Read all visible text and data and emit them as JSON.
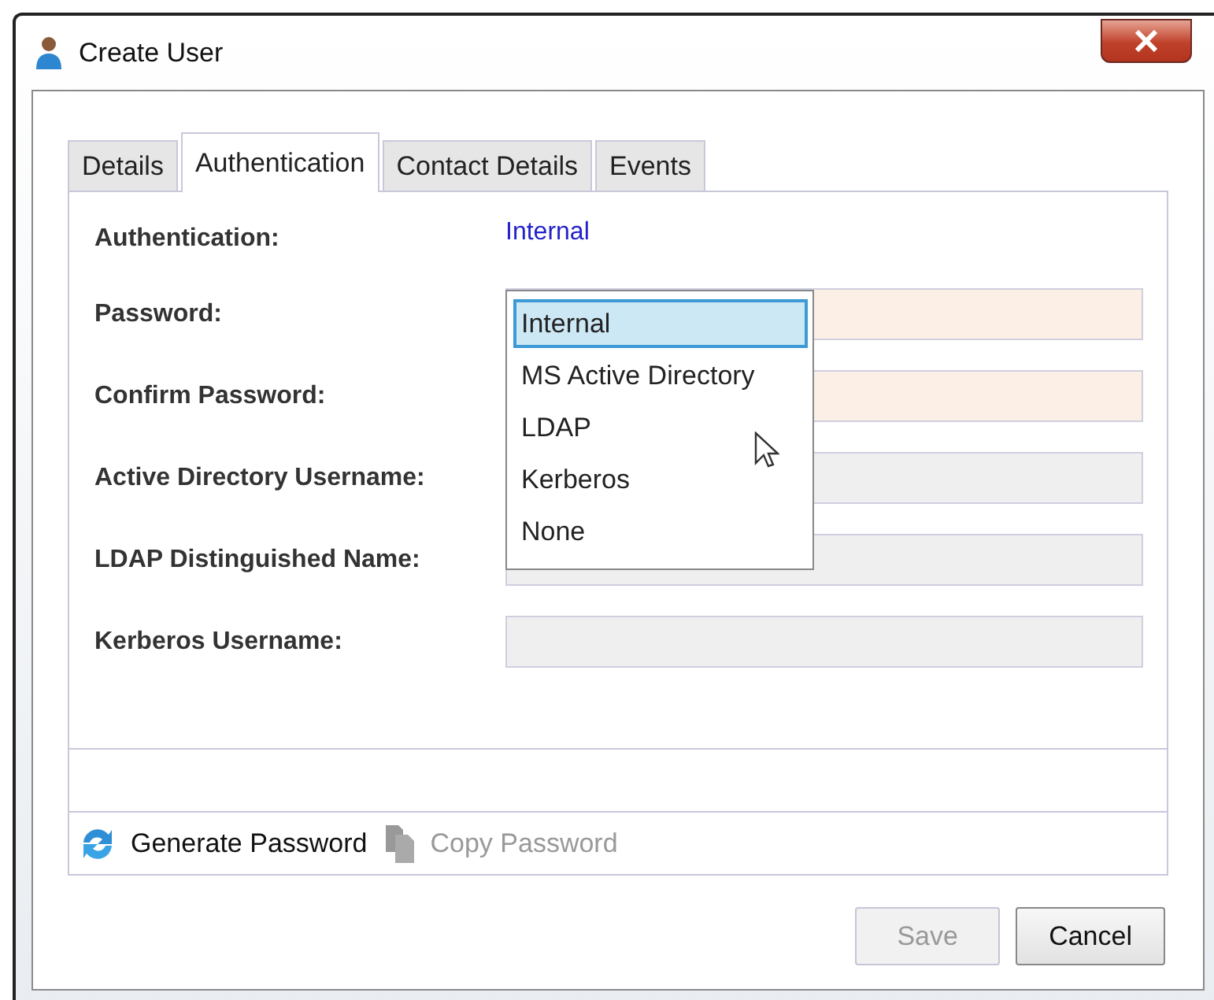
{
  "window": {
    "title": "Create User"
  },
  "tabs": [
    {
      "label": "Details",
      "selected": false
    },
    {
      "label": "Authentication",
      "selected": true
    },
    {
      "label": "Contact Details",
      "selected": false
    },
    {
      "label": "Events",
      "selected": false
    }
  ],
  "form": [
    {
      "label": "Authentication:",
      "kind": "value",
      "value": "Internal"
    },
    {
      "label": "Password:",
      "kind": "field",
      "required": true,
      "disabled": false
    },
    {
      "label": "Confirm Password:",
      "kind": "field",
      "required": true,
      "disabled": false
    },
    {
      "label": "Active Directory Username:",
      "kind": "field",
      "required": false,
      "disabled": true
    },
    {
      "label": "LDAP Distinguished Name:",
      "kind": "field",
      "required": false,
      "disabled": true
    },
    {
      "label": "Kerberos Username:",
      "kind": "field",
      "required": false,
      "disabled": true
    }
  ],
  "dropdown": {
    "options": [
      {
        "label": "Internal",
        "selected": true
      },
      {
        "label": "MS Active Directory",
        "selected": false
      },
      {
        "label": "LDAP",
        "selected": false
      },
      {
        "label": "Kerberos",
        "selected": false
      },
      {
        "label": "None",
        "selected": false
      }
    ]
  },
  "toolbar": [
    {
      "label": "Generate Password",
      "kind": "generate",
      "disabled": false
    },
    {
      "label": "Copy Password",
      "kind": "copy",
      "disabled": true
    }
  ],
  "buttons": [
    {
      "label": "Save",
      "disabled": true
    },
    {
      "label": "Cancel",
      "disabled": false
    }
  ]
}
